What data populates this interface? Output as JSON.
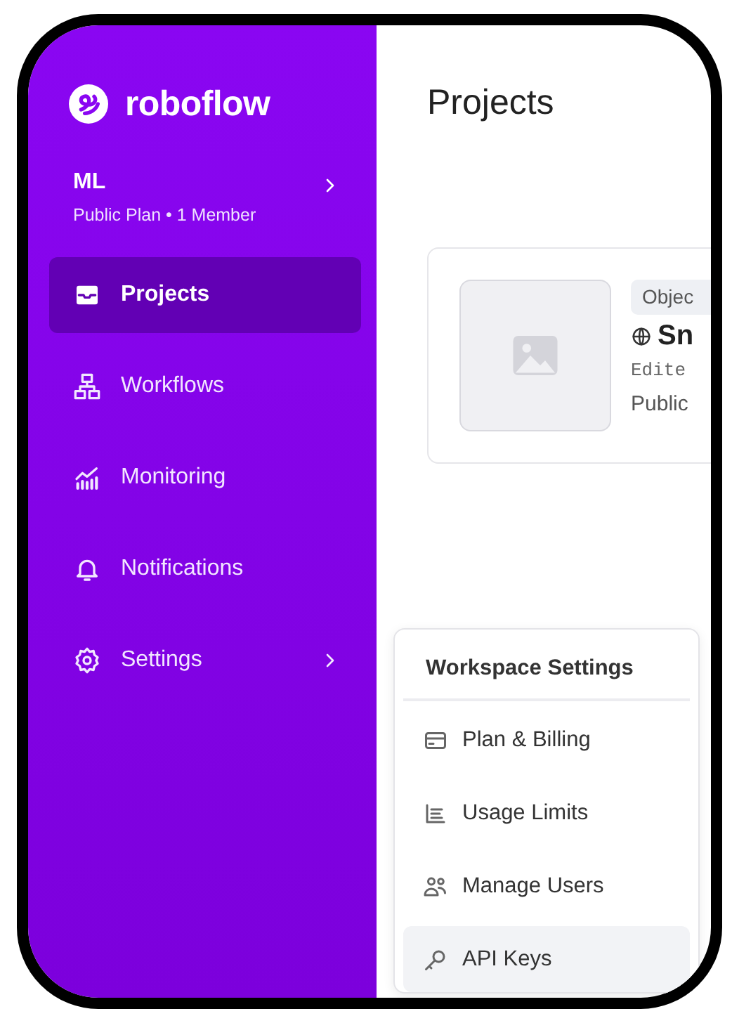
{
  "logo": {
    "text": "roboflow"
  },
  "workspace": {
    "name": "ML",
    "details": "Public Plan • 1 Member"
  },
  "nav": [
    {
      "label": "Projects",
      "selected": true,
      "has_submenu": false
    },
    {
      "label": "Workflows",
      "selected": false,
      "has_submenu": false
    },
    {
      "label": "Monitoring",
      "selected": false,
      "has_submenu": false
    },
    {
      "label": "Notifications",
      "selected": false,
      "has_submenu": false
    },
    {
      "label": "Settings",
      "selected": false,
      "has_submenu": true
    }
  ],
  "main": {
    "title": "Projects",
    "project_card": {
      "type_badge": "Objec",
      "name": "Sn",
      "edited": "Edite",
      "visibility": "Public"
    }
  },
  "settings_menu": {
    "header": "Workspace Settings",
    "items": [
      {
        "label": "Plan & Billing",
        "selected": false
      },
      {
        "label": "Usage Limits",
        "selected": false
      },
      {
        "label": "Manage Users",
        "selected": false
      },
      {
        "label": "API Keys",
        "selected": true
      }
    ]
  }
}
